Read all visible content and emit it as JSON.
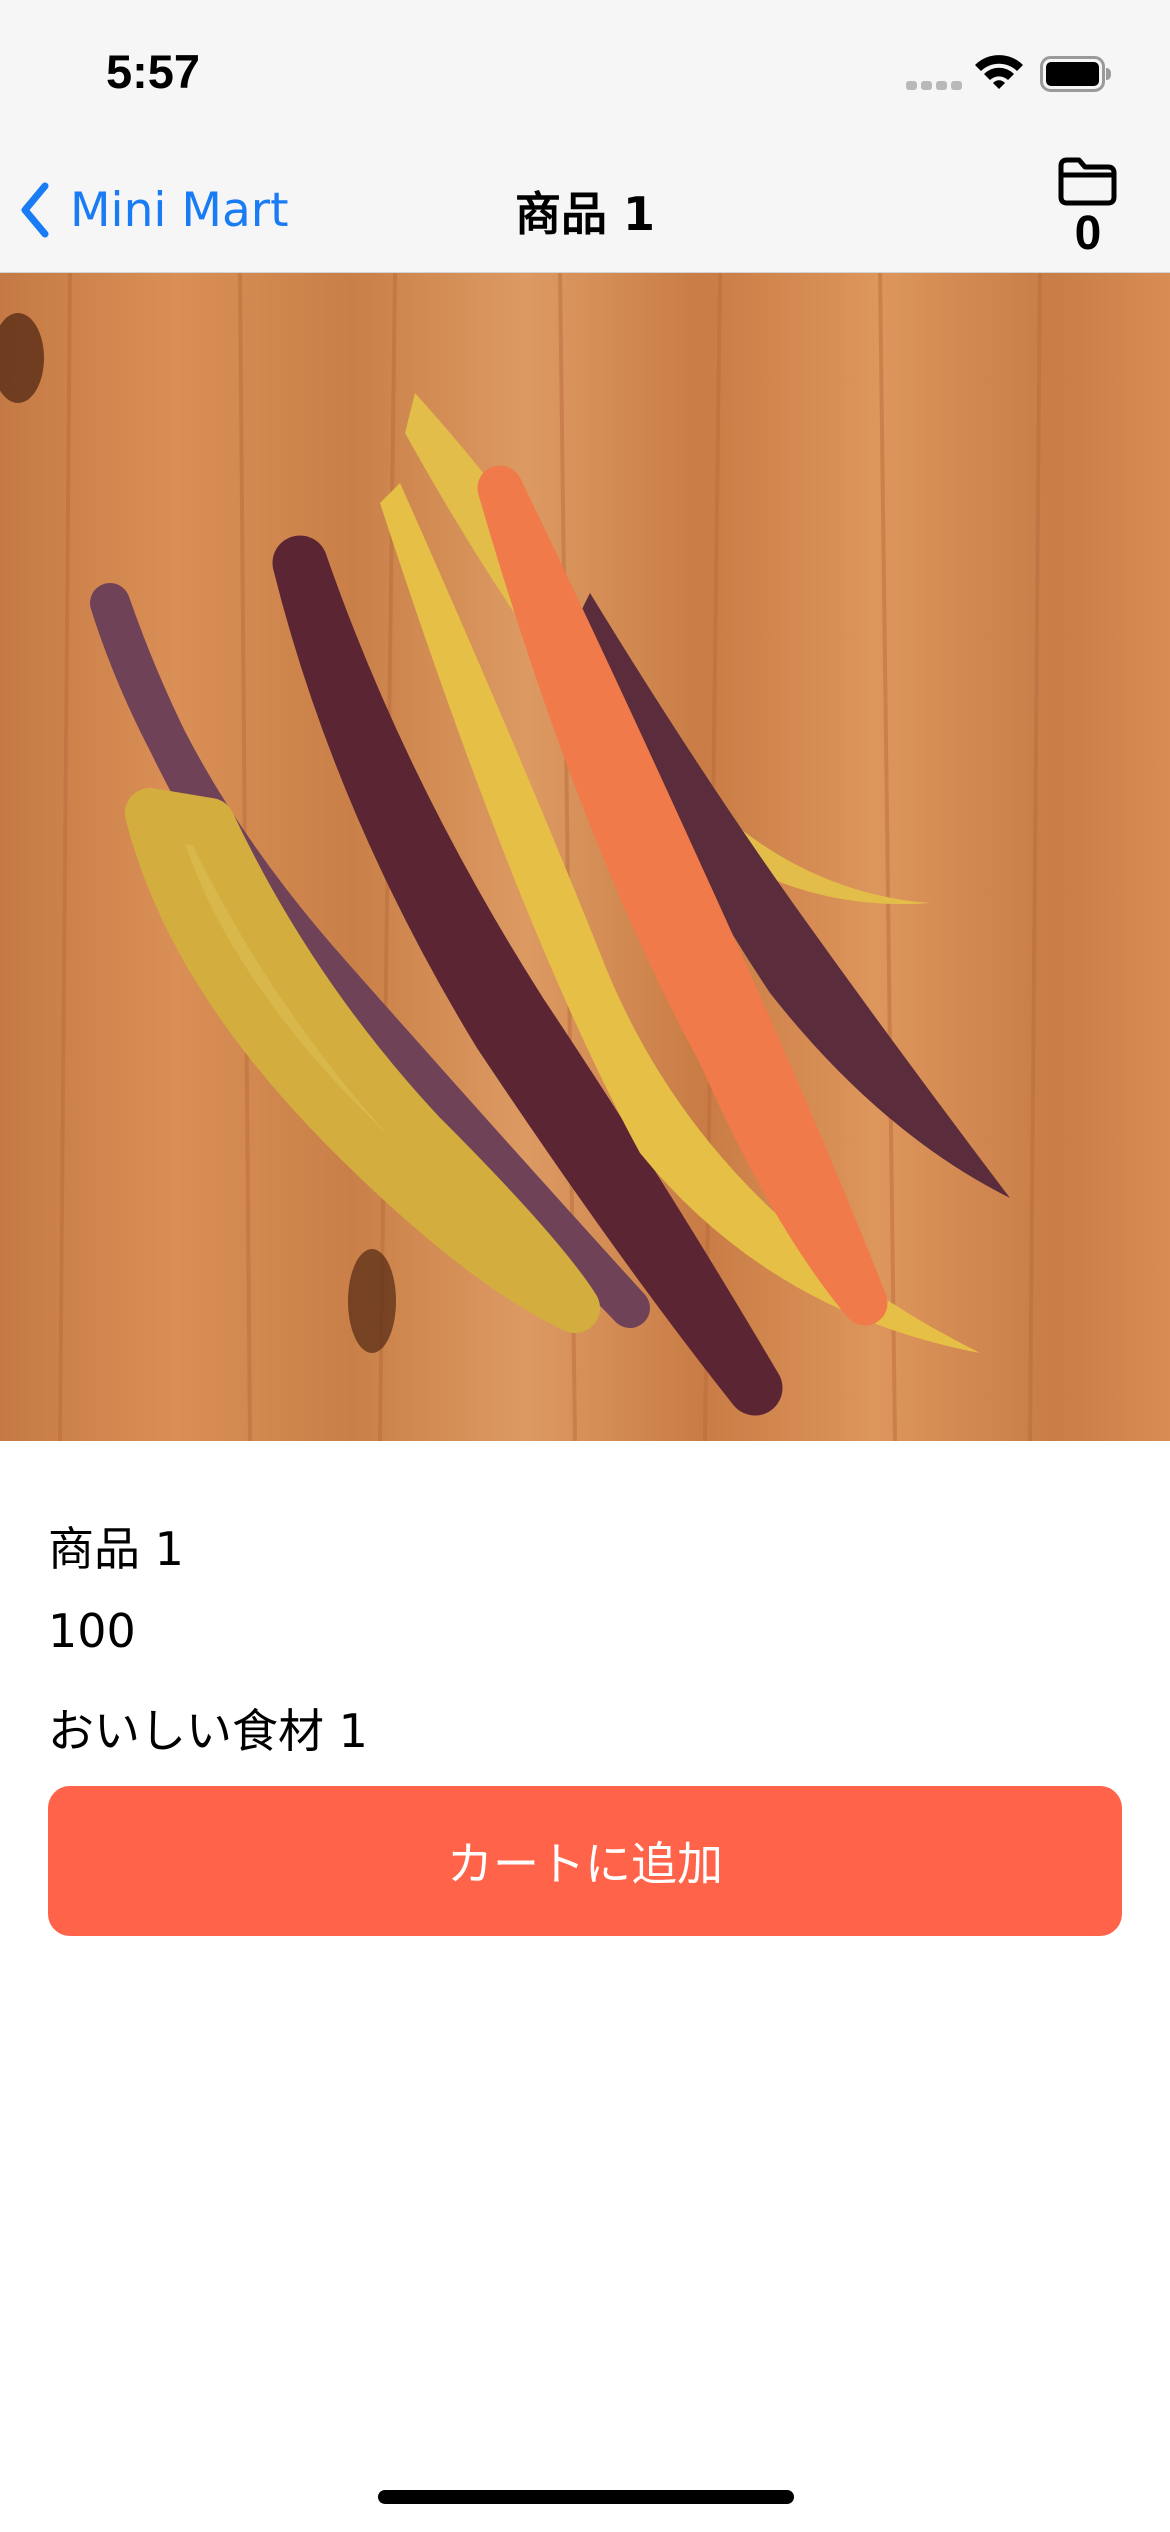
{
  "status_bar": {
    "time": "5:57"
  },
  "nav": {
    "back_label": "Mini Mart",
    "title": "商品 1",
    "cart_count": "0"
  },
  "product": {
    "name": "商品 1",
    "price": "100",
    "description": "おいしい食材 1",
    "image_alt": "carrots"
  },
  "actions": {
    "add_to_cart": "カートに追加"
  },
  "colors": {
    "accent": "#1a7cf5",
    "button": "#ff644a",
    "bar": "#f6f6f6"
  },
  "icons": {
    "back": "chevron-left-icon",
    "cart": "folder-icon"
  }
}
